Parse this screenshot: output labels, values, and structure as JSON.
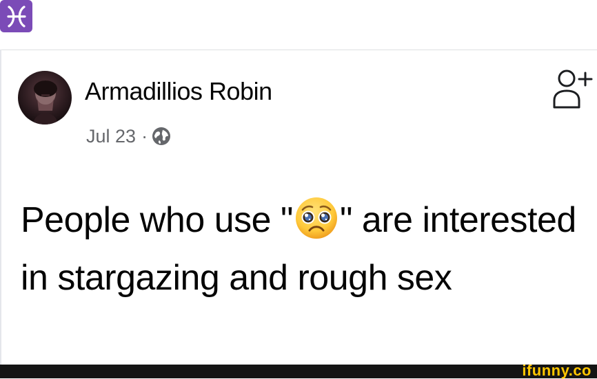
{
  "header": {
    "zodiac_icon": "pisces-icon",
    "zodiac_color": "#7b4bb7"
  },
  "post": {
    "author": "Armadillios Robin",
    "date": "Jul 23",
    "separator": "·",
    "privacy_icon": "globe-icon",
    "add_friend_icon": "add-friend-icon",
    "text_before_emoji": "People who use \"",
    "emoji": "pleading-face-emoji",
    "text_after_emoji": "\" are interested in stargazing and rough sex"
  },
  "footer": {
    "brand": "ifunny.co",
    "brand_color": "#ffc600"
  }
}
